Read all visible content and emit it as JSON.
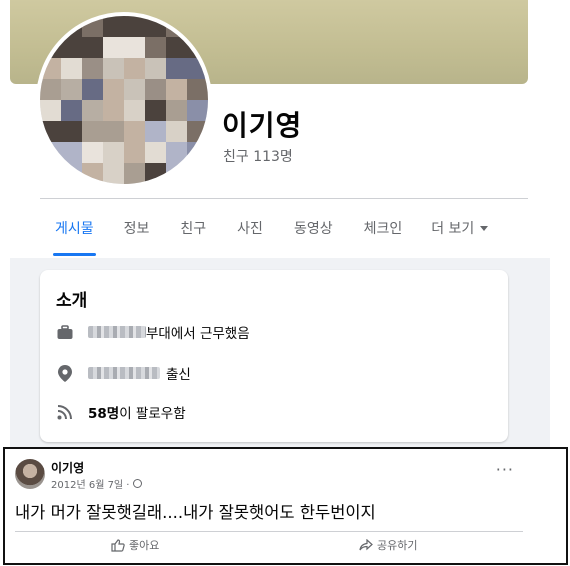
{
  "profile": {
    "name": "이기영",
    "friends": "친구 113명"
  },
  "tabs": [
    {
      "label": "게시물",
      "active": true
    },
    {
      "label": "정보",
      "active": false
    },
    {
      "label": "친구",
      "active": false
    },
    {
      "label": "사진",
      "active": false
    },
    {
      "label": "동영상",
      "active": false
    },
    {
      "label": "체크인",
      "active": false
    },
    {
      "label": "더 보기",
      "active": false
    }
  ],
  "intro": {
    "title": "소개",
    "work_suffix": "부대에서 근무했음",
    "hometown_suffix": "출신",
    "followers_count": "58명",
    "followers_suffix": "이 팔로우함"
  },
  "post": {
    "author": "이기영",
    "date": "2012년 6월 7일 ·",
    "text": "내가 머가 잘못햇길래....내가 잘못햇어도 한두번이지",
    "like_label": "좋아요",
    "share_label": "공유하기"
  },
  "colors": {
    "accent": "#1877f2",
    "secondary_text": "#65676b",
    "feed_background": "#f0f2f5"
  },
  "icons": [
    "briefcase-icon",
    "location-pin-icon",
    "rss-icon",
    "globe-icon",
    "more-options-icon",
    "thumbs-up-icon",
    "share-icon",
    "chevron-down-icon"
  ]
}
